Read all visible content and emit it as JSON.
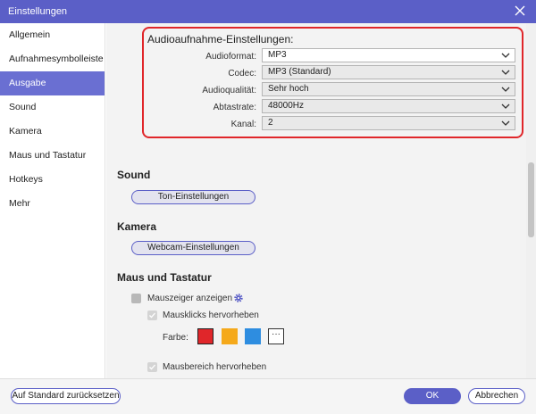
{
  "window": {
    "title": "Einstellungen"
  },
  "sidebar": {
    "items": [
      {
        "label": "Allgemein"
      },
      {
        "label": "Aufnahmesymbolleiste"
      },
      {
        "label": "Ausgabe",
        "active": true
      },
      {
        "label": "Sound"
      },
      {
        "label": "Kamera"
      },
      {
        "label": "Maus und Tastatur"
      },
      {
        "label": "Hotkeys"
      },
      {
        "label": "Mehr"
      }
    ]
  },
  "audio": {
    "heading": "Audioaufnahme-Einstellungen:",
    "fields": [
      {
        "label": "Audioformat:",
        "value": "MP3"
      },
      {
        "label": "Codec:",
        "value": "MP3 (Standard)"
      },
      {
        "label": "Audioqualität:",
        "value": "Sehr hoch"
      },
      {
        "label": "Abtastrate:",
        "value": "48000Hz"
      },
      {
        "label": "Kanal:",
        "value": "2"
      }
    ]
  },
  "sound": {
    "title": "Sound",
    "button": "Ton-Einstellungen"
  },
  "camera": {
    "title": "Kamera",
    "button": "Webcam-Einstellungen"
  },
  "mouse": {
    "title": "Maus und Tastatur",
    "show_cursor": "Mauszeiger anzeigen",
    "highlight_clicks": "Mausklicks hervorheben",
    "color_label": "Farbe:",
    "more": "···",
    "highlight_area": "Mausbereich hervorheben"
  },
  "swatches": [
    "#e0262a",
    "#f5a91b",
    "#2e8de0"
  ],
  "accent_color": "#5b5fc7",
  "footer": {
    "reset": "Auf Standard zurücksetzen",
    "ok": "OK",
    "cancel": "Abbrechen"
  }
}
